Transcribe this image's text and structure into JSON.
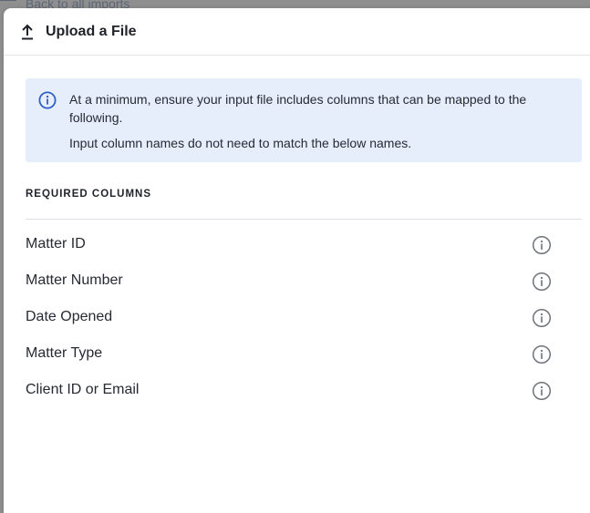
{
  "backdrop": {
    "link_text": "Back to all imports"
  },
  "modal": {
    "title": "Upload a File",
    "icon": "upload-icon"
  },
  "info": {
    "icon": "info-icon",
    "line1": "At a minimum, ensure your input file includes columns that can be mapped to the following.",
    "line2": "Input column names do not need to match the below names."
  },
  "required_columns": {
    "heading": "REQUIRED COLUMNS",
    "items": [
      {
        "label": "Matter ID"
      },
      {
        "label": "Matter Number"
      },
      {
        "label": "Date Opened"
      },
      {
        "label": "Matter Type"
      },
      {
        "label": "Client ID or Email"
      }
    ]
  },
  "colors": {
    "accent": "#2d5fc4",
    "info_bg": "#e7eefb",
    "backdrop": "#8f8f8f"
  }
}
